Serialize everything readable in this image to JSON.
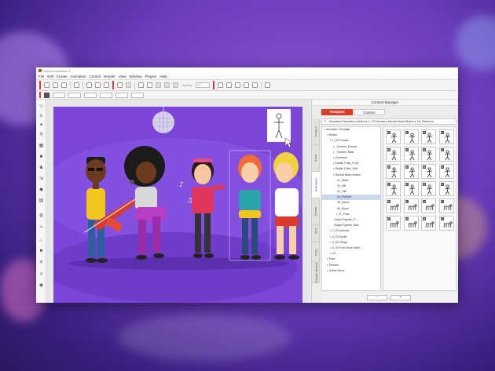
{
  "window": {
    "title": "Cartoon Animator 4"
  },
  "menu": [
    "File",
    "Edit",
    "Create",
    "Animation",
    "Control",
    "Render",
    "View",
    "Window",
    "Plugins",
    "Help"
  ],
  "toolbar": {
    "opacity_label": "Opacity",
    "opacity_value": "100"
  },
  "content_manager": {
    "title": "Content Manager",
    "tabs": [
      {
        "label": "Template",
        "active": true
      },
      {
        "label": "Custom",
        "active": false
      }
    ],
    "side_tabs": [
      "Project",
      "Actor",
      "Animation",
      "Scene",
      "SFX",
      "Prop",
      "Elastic Motion"
    ],
    "path": "Animation Template ▸ Motion ▸ 1_G3 Human ▸ Human Basic Motion ▸ 04_Perform ▸",
    "tree": [
      {
        "label": "Animation Template",
        "level": 0,
        "expanded": true
      },
      {
        "label": "Motion",
        "level": 1,
        "expanded": true
      },
      {
        "label": "1_G3 Human",
        "level": 2,
        "expanded": true
      },
      {
        "label": "_Toonies_Female",
        "level": 3,
        "expanded": false
      },
      {
        "label": "_Toonies_Male",
        "level": 3,
        "expanded": false
      },
      {
        "label": "Caveman",
        "level": 3,
        "expanded": false
      },
      {
        "label": "Elastic Folks_Front",
        "level": 3,
        "expanded": false
      },
      {
        "label": "Elastic Folks_Side",
        "level": 3,
        "expanded": false
      },
      {
        "label": "Human Basic Motion",
        "level": 3,
        "expanded": true
      },
      {
        "label": "01_Move",
        "level": 4
      },
      {
        "label": "02_Idle",
        "level": 4
      },
      {
        "label": "03_Talk",
        "level": 4
      },
      {
        "label": "04_Perform",
        "level": 4,
        "selected": true
      },
      {
        "label": "05_Dance",
        "level": 4
      },
      {
        "label": "06_Mood",
        "level": 4
      },
      {
        "label": "07_Pose",
        "level": 4,
        "expanded": false
      },
      {
        "label": "Vogue Figures_Fr...",
        "level": 3
      },
      {
        "label": "Vogue Figures_Side",
        "level": 3
      },
      {
        "label": "2_G3 Animals",
        "level": 2,
        "expanded": false
      },
      {
        "label": "3_G3 Sprite",
        "level": 2,
        "expanded": false
      },
      {
        "label": "4_G3 Wings",
        "level": 2,
        "expanded": false
      },
      {
        "label": "5_G3 Free Bone Earth...",
        "level": 2,
        "expanded": false
      },
      {
        "label": "G2",
        "level": 2,
        "expanded": false
      },
      {
        "label": "Face",
        "level": 1,
        "expanded": false
      },
      {
        "label": "Perform",
        "level": 1,
        "expanded": false
      },
      {
        "label": "Action Menu",
        "level": 1,
        "expanded": false
      }
    ],
    "thumbnails": [
      "man",
      "man",
      "man",
      "man",
      "man",
      "man",
      "man",
      "man",
      "man",
      "man",
      "man",
      "man",
      "man",
      "man",
      "man",
      "man",
      "animal",
      "animal",
      "animal",
      "animal",
      "animal",
      "animal",
      "animal",
      "animal"
    ],
    "buttons": [
      "−",
      "+"
    ]
  },
  "colors": {
    "accent": "#e03a2a",
    "stage": "#7b45d8"
  }
}
